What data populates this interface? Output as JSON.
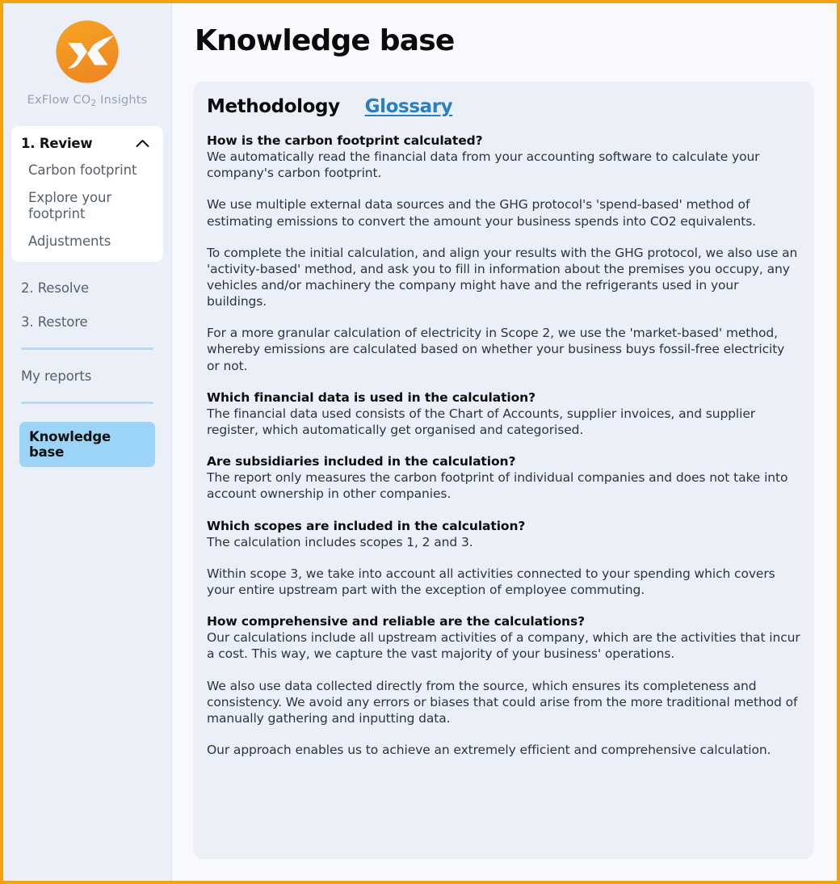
{
  "window": {
    "accent_border_color": "#f0a413"
  },
  "sidebar": {
    "brand": {
      "name_prefix": "ExFlow CO",
      "name_sub": "2",
      "name_suffix": " Insights",
      "logo_color": "#f0901e"
    },
    "review_group": {
      "label": "1. Review",
      "expanded": true,
      "items": [
        {
          "label": "Carbon footprint"
        },
        {
          "label": "Explore your footprint"
        },
        {
          "label": "Adjustments"
        }
      ]
    },
    "steps": [
      {
        "label": "2. Resolve"
      },
      {
        "label": "3. Restore"
      }
    ],
    "reports_label": "My reports",
    "active_item": {
      "label": "Knowledge base",
      "highlight_color": "#9cd4f7"
    }
  },
  "main": {
    "page_title": "Knowledge base",
    "tabs": [
      {
        "label": "Methodology",
        "active": true
      },
      {
        "label": "Glossary",
        "active": false,
        "link_color": "#2a7fc0"
      }
    ],
    "faq": [
      {
        "question": "How is the carbon footprint calculated?",
        "paragraphs": [
          "We automatically read the financial data from your accounting software to calculate your company's carbon footprint.",
          "We use multiple external data sources and the GHG protocol's 'spend-based' method of estimating emissions to convert the amount your business spends into CO2 equivalents.",
          "To complete the initial calculation, and align your results with the GHG protocol, we also use an 'activity-based' method, and ask you to fill in information about the premises you occupy, any vehicles and/or machinery the company might have and the refrigerants used in your buildings.",
          "For a more granular calculation of electricity in Scope 2, we use the 'market-based' method, whereby emissions are calculated based on whether your business buys fossil-free electricity or not."
        ]
      },
      {
        "question": "Which financial data is used in the calculation?",
        "paragraphs": [
          "The financial data used consists of the Chart of Accounts, supplier invoices, and supplier register, which automatically get organised and categorised."
        ]
      },
      {
        "question": "Are subsidiaries included in the calculation?",
        "paragraphs": [
          "The report only measures the carbon footprint of individual companies and does not take into account ownership in other companies."
        ]
      },
      {
        "question": "Which scopes are included in the calculation?",
        "paragraphs": [
          "The calculation includes scopes 1, 2 and 3.",
          "Within scope 3, we take into account all activities connected to your spending which covers your entire upstream part with the exception of employee commuting."
        ]
      },
      {
        "question": "How comprehensive and reliable are the calculations?",
        "paragraphs": [
          "Our calculations include all upstream activities of a company, which are the activities that incur a cost. This way, we capture the vast majority of your business' operations.",
          "We also use data collected directly from the source, which ensures its completeness and consistency. We avoid any errors or biases that could arise from the more traditional method of manually gathering and inputting data.",
          "Our approach enables us to achieve an extremely efficient and comprehensive calculation."
        ]
      }
    ]
  }
}
